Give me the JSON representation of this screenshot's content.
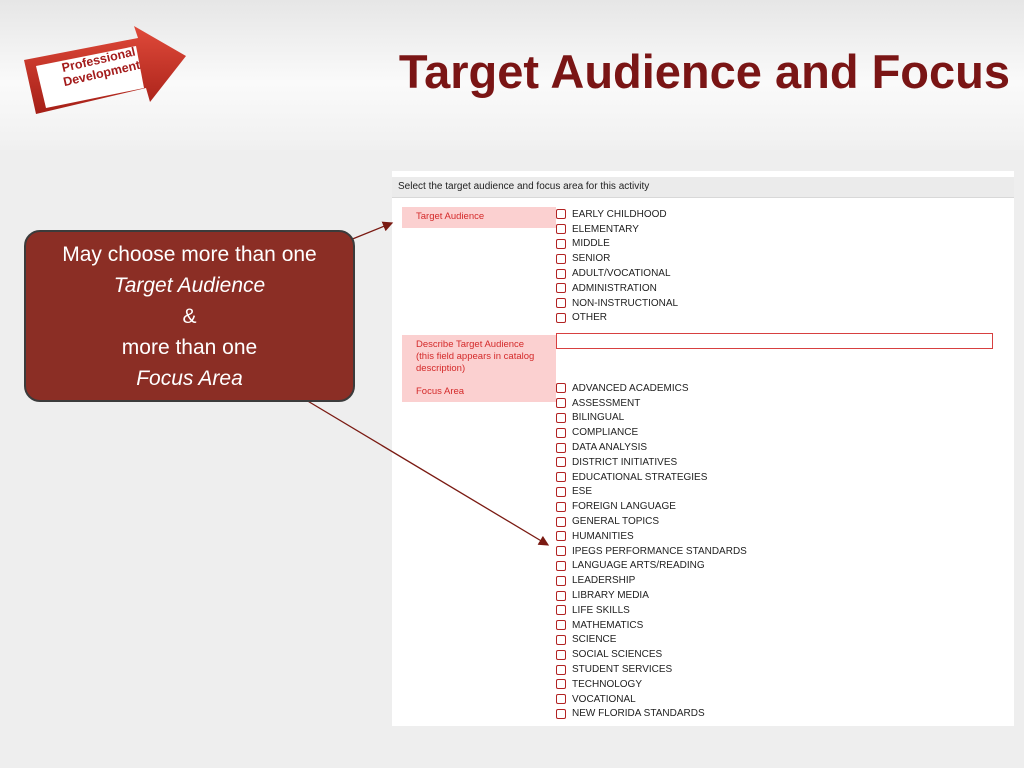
{
  "header": {
    "logo_line1": "Professional",
    "logo_line2": "Development",
    "title": "Target Audience and Focus"
  },
  "panel": {
    "instruction": "Select the target audience and focus area for this activity",
    "target_audience_label": "Target Audience",
    "target_audience_options": [
      "EARLY CHILDHOOD",
      "ELEMENTARY",
      "MIDDLE",
      "SENIOR",
      "ADULT/VOCATIONAL",
      "ADMINISTRATION",
      "NON-INSTRUCTIONAL",
      "OTHER"
    ],
    "describe_label_line1": "Describe Target Audience",
    "describe_label_line2": "(this field appears in catalog",
    "describe_label_line3": "description)",
    "describe_value": "",
    "focus_area_label": "Focus Area",
    "focus_area_options": [
      "ADVANCED ACADEMICS",
      "ASSESSMENT",
      "BILINGUAL",
      "COMPLIANCE",
      "DATA ANALYSIS",
      "DISTRICT INITIATIVES",
      "EDUCATIONAL STRATEGIES",
      "ESE",
      "FOREIGN LANGUAGE",
      "GENERAL TOPICS",
      "HUMANITIES",
      "IPEGS PERFORMANCE STANDARDS",
      "LANGUAGE ARTS/READING",
      "LEADERSHIP",
      "LIBRARY MEDIA",
      "LIFE SKILLS",
      "MATHEMATICS",
      "SCIENCE",
      "SOCIAL SCIENCES",
      "STUDENT SERVICES",
      "TECHNOLOGY",
      "VOCATIONAL",
      "NEW FLORIDA STANDARDS"
    ]
  },
  "callout": {
    "line1": "May choose more than one",
    "line2": "Target Audience",
    "line3": "&",
    "line4": "more than one",
    "line5": "Focus Area"
  },
  "colors": {
    "title": "#7a1515",
    "callout_bg": "#8b2e25",
    "label_bg": "#fbd0d0",
    "label_text": "#d42a2a",
    "checkbox_border": "#b22222"
  }
}
